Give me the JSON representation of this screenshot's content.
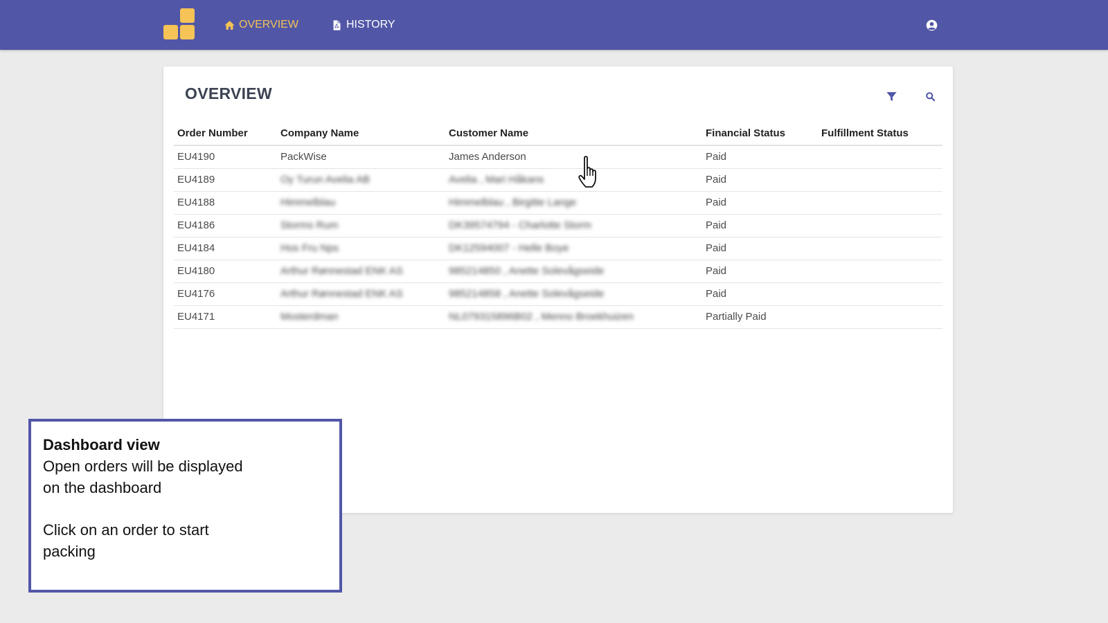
{
  "colors": {
    "nav_background": "#5156a6",
    "nav_active": "#f5c356",
    "nav_text": "#ffffff",
    "logo_yellow": "#f5c356",
    "icon_accent": "#5156a6",
    "callout_border": "#5156a6"
  },
  "nav": {
    "logo_icon": "app-logo-squares",
    "items": [
      {
        "label": "OVERVIEW",
        "icon": "home-icon",
        "active": true
      },
      {
        "label": "HISTORY",
        "icon": "file-pdf-icon",
        "active": false
      }
    ],
    "user_icon": "user-circle-icon"
  },
  "overview": {
    "title": "OVERVIEW",
    "filter_icon": "filter-icon",
    "search_icon": "search-icon",
    "columns": [
      "Order Number",
      "Company Name",
      "Customer Name",
      "Financial Status",
      "Fulfillment Status"
    ],
    "rows": [
      {
        "order": "EU4190",
        "company": "PackWise",
        "customer": "James Anderson",
        "financial": "Paid",
        "fulfillment": "",
        "blurred": false
      },
      {
        "order": "EU4189",
        "company": "Oy Turun Avelia AB",
        "customer": "Avelia , Mari Håkans",
        "financial": "Paid",
        "fulfillment": "",
        "blurred": true
      },
      {
        "order": "EU4188",
        "company": "Himmelblau",
        "customer": "Himmelblau , Birgitte Lange",
        "financial": "Paid",
        "fulfillment": "",
        "blurred": true
      },
      {
        "order": "EU4186",
        "company": "Storms Rum",
        "customer": "DK39574794 - Charlotte Storm",
        "financial": "Paid",
        "fulfillment": "",
        "blurred": true
      },
      {
        "order": "EU4184",
        "company": "Hos Fru Nps",
        "customer": "DK12594007 - Helle Boye",
        "financial": "Paid",
        "fulfillment": "",
        "blurred": true
      },
      {
        "order": "EU4180",
        "company": "Arthur Rønnestad ENK AS",
        "customer": "985214850 , Anette Solevågseide",
        "financial": "Paid",
        "fulfillment": "",
        "blurred": true
      },
      {
        "order": "EU4176",
        "company": "Arthur Rønnestad ENK AS",
        "customer": "985214858 , Anette Solevågseide",
        "financial": "Paid",
        "fulfillment": "",
        "blurred": true
      },
      {
        "order": "EU4171",
        "company": "Mosterdman",
        "customer": "NL079315896B02 , Menno Broekhuizen",
        "financial": "Partially Paid",
        "fulfillment": "",
        "blurred": true
      }
    ]
  },
  "cursor_icon": "hand-pointer-cursor-icon",
  "callout": {
    "title": "Dashboard view",
    "line1": "Open orders will be displayed on the dashboard",
    "line2": "Click on an order to start packing"
  }
}
